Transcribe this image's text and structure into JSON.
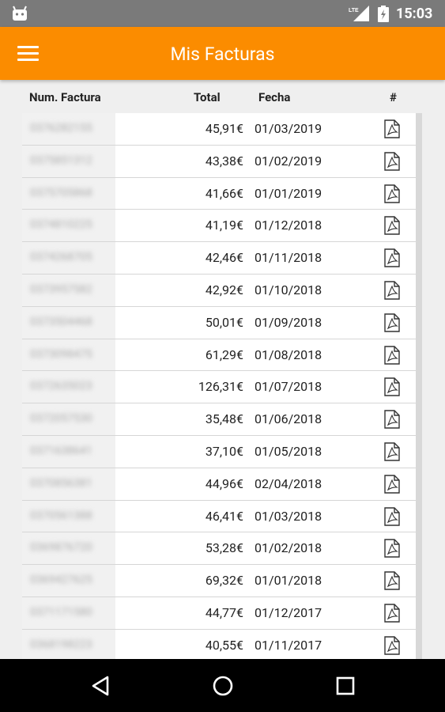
{
  "status_bar": {
    "time": "15:03",
    "network": "LTE"
  },
  "app_bar": {
    "title": "Mis Facturas"
  },
  "table": {
    "headers": {
      "num": "Num. Factura",
      "total": "Total",
      "fecha": "Fecha",
      "hash": "#"
    },
    "rows": [
      {
        "num": "0376282155",
        "total": "45,91€",
        "fecha": "01/03/2019"
      },
      {
        "num": "0375851312",
        "total": "43,38€",
        "fecha": "01/02/2019"
      },
      {
        "num": "0375705868",
        "total": "41,66€",
        "fecha": "01/01/2019"
      },
      {
        "num": "0374810225",
        "total": "41,19€",
        "fecha": "01/12/2018"
      },
      {
        "num": "0374268705",
        "total": "42,46€",
        "fecha": "01/11/2018"
      },
      {
        "num": "0373957582",
        "total": "42,92€",
        "fecha": "01/10/2018"
      },
      {
        "num": "0373504468",
        "total": "50,01€",
        "fecha": "01/09/2018"
      },
      {
        "num": "0373098475",
        "total": "61,29€",
        "fecha": "01/08/2018"
      },
      {
        "num": "0372635023",
        "total": "126,31€",
        "fecha": "01/07/2018"
      },
      {
        "num": "0372057530",
        "total": "35,48€",
        "fecha": "01/06/2018"
      },
      {
        "num": "0371638641",
        "total": "37,10€",
        "fecha": "01/05/2018"
      },
      {
        "num": "0370856381",
        "total": "44,96€",
        "fecha": "02/04/2018"
      },
      {
        "num": "0370561388",
        "total": "46,41€",
        "fecha": "01/03/2018"
      },
      {
        "num": "0369876720",
        "total": "53,28€",
        "fecha": "01/02/2018"
      },
      {
        "num": "0369427625",
        "total": "69,32€",
        "fecha": "01/01/2018"
      },
      {
        "num": "0371171580",
        "total": "44,77€",
        "fecha": "01/12/2017"
      },
      {
        "num": "0368198223",
        "total": "40,55€",
        "fecha": "01/11/2017"
      }
    ]
  },
  "icons": {
    "row_action": "pdf-file-icon",
    "menu": "hamburger-menu-icon",
    "nav_back": "back-triangle-icon",
    "nav_home": "home-circle-icon",
    "nav_recents": "recents-square-icon"
  },
  "colors": {
    "app_bar": "#fb8c00",
    "status_bar": "#7a7a7a",
    "nav_bar": "#000000"
  }
}
